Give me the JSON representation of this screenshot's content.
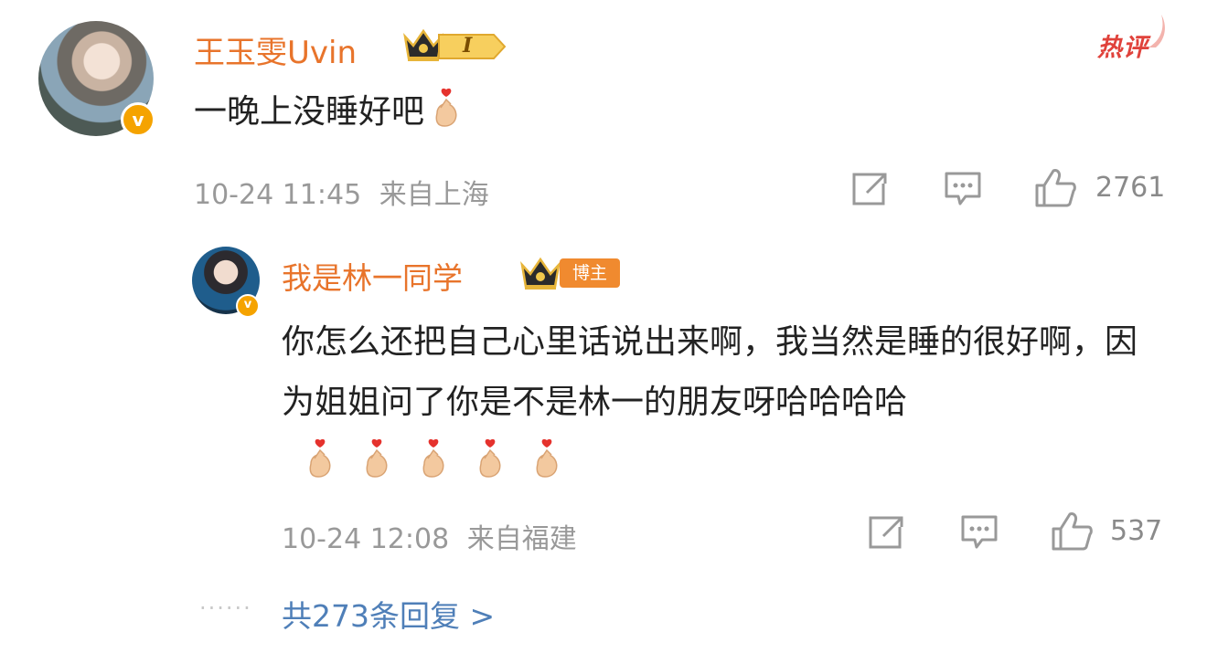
{
  "hot_tag": "热评",
  "comment": {
    "username": "王玉雯Uvin",
    "level_badge": "I",
    "text": "一晚上没睡好吧",
    "time": "10-24 11:45",
    "location": "来自上海",
    "like_count": "2761"
  },
  "reply": {
    "username": "我是林一同学",
    "role_badge": "博主",
    "text": "你怎么还把自己心里话说出来啊，我当然是睡的很好啊，因为姐姐问了你是不是林一的朋友呀哈哈哈哈",
    "time": "10-24 12:08",
    "location": "来自福建",
    "like_count": "537"
  },
  "more_replies": "共273条回复 >",
  "icons": {
    "verified": "v-badge-icon",
    "crown": "crown-icon",
    "repost": "repost-icon",
    "comment": "comment-icon",
    "like": "thumbs-up-icon",
    "emoji": "finger-heart-emoji"
  },
  "colors": {
    "username": "#e8742b",
    "meta": "#999999",
    "link": "#4f7fb8",
    "hot": "#e0423b",
    "verified": "#f5a300"
  }
}
